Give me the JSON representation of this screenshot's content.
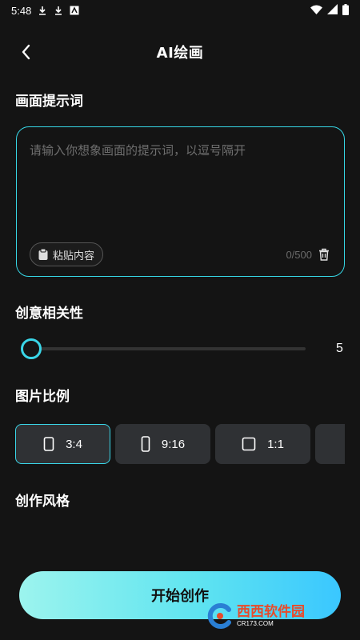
{
  "status_bar": {
    "time": "5:48",
    "icons": [
      "download-icon",
      "download-icon",
      "app-notification-icon",
      "wifi-icon",
      "signal-icon",
      "battery-icon"
    ]
  },
  "header": {
    "back_icon": "chevron-left-icon",
    "title": "AI绘画"
  },
  "prompt_section": {
    "label": "画面提示词",
    "placeholder": "请输入你想象画面的提示词，以逗号隔开",
    "value": "",
    "paste_label": "粘贴内容",
    "counter": "0/500",
    "accent": "#36d7e6"
  },
  "relevance_section": {
    "label": "创意相关性",
    "value": "5",
    "level_fraction": 0.0
  },
  "ratio_section": {
    "label": "图片比例",
    "options": [
      {
        "label": "3:4",
        "icon": "portrait-rect-icon",
        "selected": true
      },
      {
        "label": "9:16",
        "icon": "tall-rect-icon",
        "selected": false
      },
      {
        "label": "1:1",
        "icon": "square-icon",
        "selected": false
      },
      {
        "label": "",
        "icon": "rect-icon",
        "selected": false
      }
    ]
  },
  "style_section": {
    "label": "创作风格"
  },
  "start_button": {
    "label": "开始创作"
  },
  "watermark": {
    "main": "西西软件园",
    "sub": "CR173.COM"
  }
}
